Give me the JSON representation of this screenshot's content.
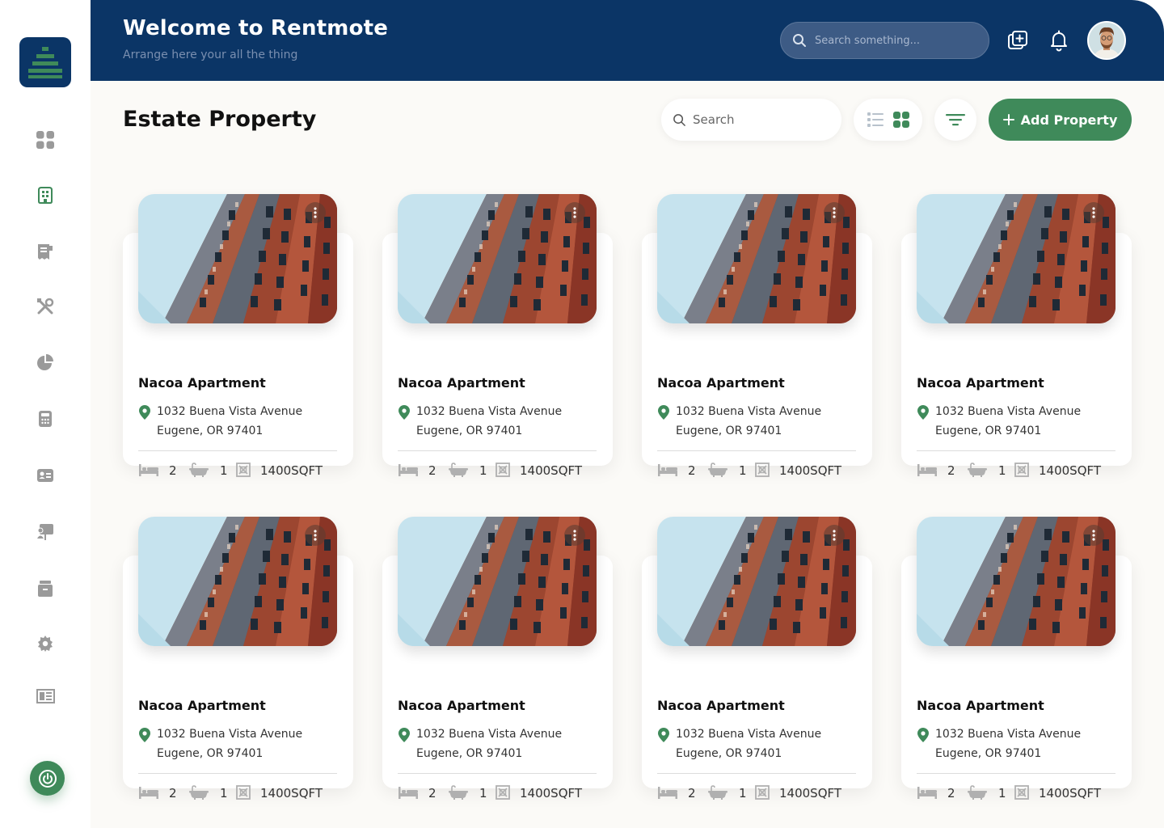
{
  "header": {
    "title": "Welcome to Rentmote",
    "subtitle": "Arrange here your all the thing",
    "search_placeholder": "Search something..."
  },
  "sidebar": {
    "items": [
      {
        "name": "dashboard-icon",
        "active": false
      },
      {
        "name": "property-icon",
        "active": true
      },
      {
        "name": "receipt-icon",
        "active": false
      },
      {
        "name": "tools-icon",
        "active": false
      },
      {
        "name": "pie-chart-icon",
        "active": false
      },
      {
        "name": "calculator-icon",
        "active": false
      },
      {
        "name": "id-card-icon",
        "active": false
      },
      {
        "name": "presentation-icon",
        "active": false
      },
      {
        "name": "folder-icon",
        "active": false
      },
      {
        "name": "settings-icon",
        "active": false
      },
      {
        "name": "news-icon",
        "active": false
      }
    ]
  },
  "main": {
    "title": "Estate Property",
    "search_placeholder": "Search",
    "add_label": "Add Property"
  },
  "colors": {
    "navy": "#0b3566",
    "green": "#3f8a5a",
    "icon_gray": "#9a9a9a"
  },
  "properties": [
    {
      "name": "Nacoa Apartment",
      "address_line1": "1032 Buena Vista Avenue",
      "address_line2": "Eugene, OR 97401",
      "beds": "2",
      "baths": "1",
      "area": "1400SQFT"
    },
    {
      "name": "Nacoa Apartment",
      "address_line1": "1032 Buena Vista Avenue",
      "address_line2": "Eugene, OR 97401",
      "beds": "2",
      "baths": "1",
      "area": "1400SQFT"
    },
    {
      "name": "Nacoa Apartment",
      "address_line1": "1032 Buena Vista Avenue",
      "address_line2": "Eugene, OR 97401",
      "beds": "2",
      "baths": "1",
      "area": "1400SQFT"
    },
    {
      "name": "Nacoa Apartment",
      "address_line1": "1032 Buena Vista Avenue",
      "address_line2": "Eugene, OR 97401",
      "beds": "2",
      "baths": "1",
      "area": "1400SQFT"
    },
    {
      "name": "Nacoa Apartment",
      "address_line1": "1032 Buena Vista Avenue",
      "address_line2": "Eugene, OR 97401",
      "beds": "2",
      "baths": "1",
      "area": "1400SQFT"
    },
    {
      "name": "Nacoa Apartment",
      "address_line1": "1032 Buena Vista Avenue",
      "address_line2": "Eugene, OR 97401",
      "beds": "2",
      "baths": "1",
      "area": "1400SQFT"
    },
    {
      "name": "Nacoa Apartment",
      "address_line1": "1032 Buena Vista Avenue",
      "address_line2": "Eugene, OR 97401",
      "beds": "2",
      "baths": "1",
      "area": "1400SQFT"
    },
    {
      "name": "Nacoa Apartment",
      "address_line1": "1032 Buena Vista Avenue",
      "address_line2": "Eugene, OR 97401",
      "beds": "2",
      "baths": "1",
      "area": "1400SQFT"
    }
  ]
}
